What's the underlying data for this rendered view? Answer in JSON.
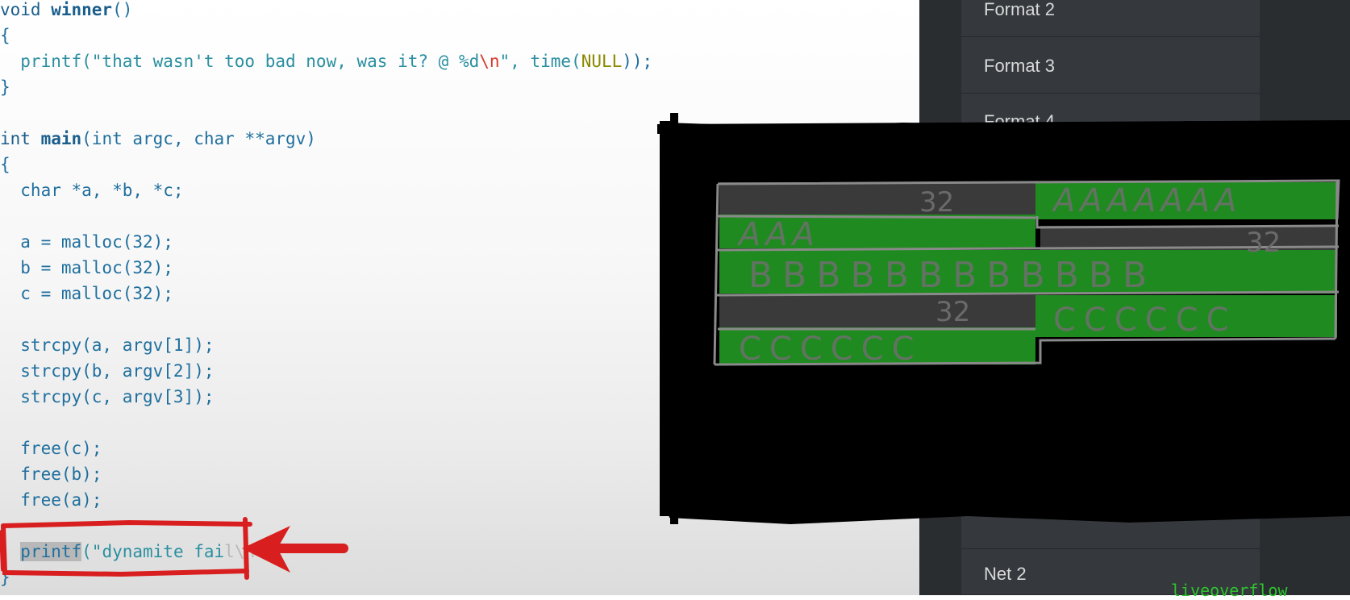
{
  "code": {
    "line1": [
      "void ",
      "winner",
      "()"
    ],
    "line2": "{",
    "line3": [
      "  printf(\"that wasn't too bad now, was it? @ %d",
      "\\n",
      "\", time(",
      "NULL",
      "));"
    ],
    "line4": "}",
    "line5": "",
    "line6": [
      "int ",
      "main",
      "(int argc, char **argv)"
    ],
    "line7": "{",
    "line8": "  char *a, *b, *c;",
    "line9": "",
    "line10": "  a = malloc(32);",
    "line11": "  b = malloc(32);",
    "line12": "  c = malloc(32);",
    "line13": "",
    "line14": "  strcpy(a, argv[1]);",
    "line15": "  strcpy(b, argv[2]);",
    "line16": "  strcpy(c, argv[3]);",
    "line17": "",
    "line18": "  free(c);",
    "line19": "  free(b);",
    "line20": "  free(a);",
    "line21": "",
    "line22": [
      "  ",
      "printf",
      "(\"dynamite fai",
      "l\\n\");"
    ],
    "line23": "}"
  },
  "menu": {
    "items": [
      "Format 2",
      "Format 3",
      "Format 4",
      "Net 2"
    ]
  },
  "diagram": {
    "size_labels": [
      "32",
      "32",
      "32"
    ],
    "row_a": "AAAAAAA",
    "row_a2": "AAA",
    "row_b": "BBBBBBBBBBBB",
    "row_c": "CCCCCC",
    "row_c2": "CCCCCC"
  },
  "watermark": "liveoverflow",
  "colors": {
    "annotation_red": "#d81e1e",
    "heap_green": "#1f8a1f",
    "chunk_header_gray": "#3a3a3a",
    "panel_bg": "#2a2d30"
  }
}
